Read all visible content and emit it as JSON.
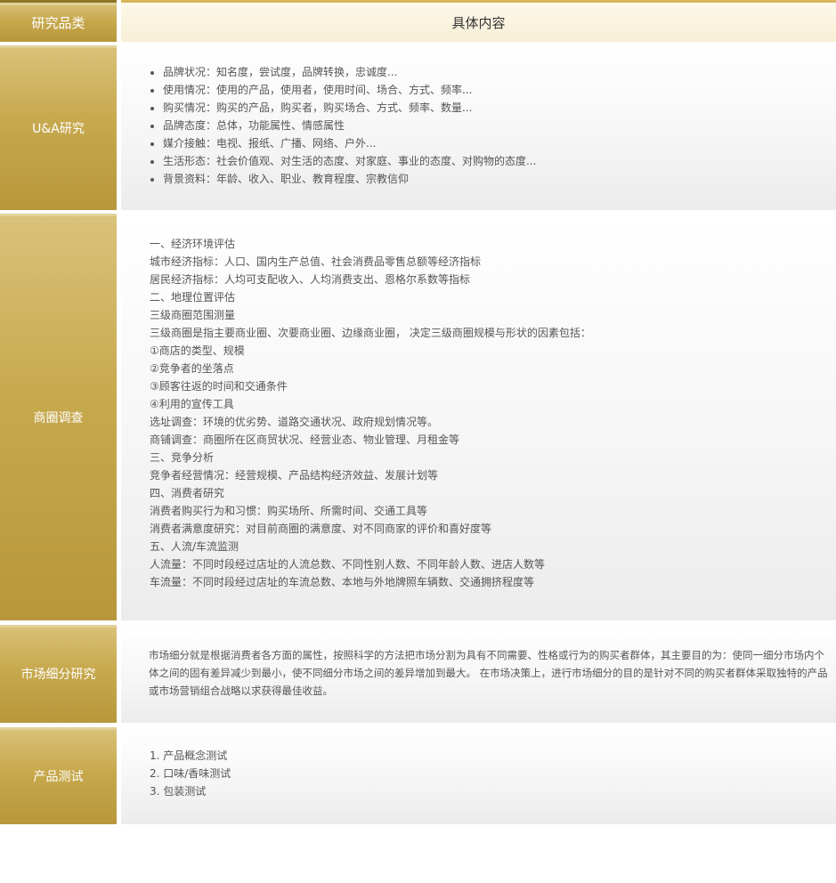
{
  "header": {
    "category": "研究品类",
    "content": "具体内容"
  },
  "ua": {
    "category": "U&A研究",
    "items": [
      "品牌状况：知名度，尝试度，品牌转换，忠诚度...",
      "使用情况：使用的产品，使用者，使用时间、场合、方式、频率...",
      "购买情况：购买的产品，购买者，购买场合、方式、频率、数量...",
      "品牌态度：总体，功能属性、情感属性",
      "媒介接触：电视、报纸、广播、网络、户外...",
      "生活形态：社会价值观、对生活的态度、对家庭、事业的态度、对购物的态度...",
      "背景资料：年龄、收入、职业、教育程度、宗教信仰"
    ]
  },
  "trade": {
    "category": "商圈调查",
    "lines": [
      "一、经济环境评估",
      "城市经济指标：人口、国内生产总值、社会消费品零售总额等经济指标",
      "居民经济指标：人均可支配收入、人均消费支出、恩格尔系数等指标",
      "二、地理位置评估",
      "三级商圈范围测量",
      "三级商圈是指主要商业圈、次要商业圈、边缘商业圈， 决定三级商圈规模与形状的因素包括：",
      "①商店的类型、规模",
      "②竞争者的坐落点",
      "③顾客往返的时间和交通条件",
      "④利用的宣传工具",
      "选址调查：环境的优劣势、道路交通状况、政府规划情况等。",
      "商铺调查：商圈所在区商贸状况、经营业态、物业管理、月租金等",
      "三、竞争分析",
      "竞争者经营情况：经营规模、产品结构经济效益、发展计划等",
      "四、消费者研究",
      "消费者购买行为和习惯：购买场所、所需时间、交通工具等",
      "消费者满意度研究：对目前商圈的满意度、对不同商家的评价和喜好度等",
      "五、人流/车流监测",
      "人流量：不同时段经过店址的人流总数、不同性别人数、不同年龄人数、进店人数等",
      "车流量：不同时段经过店址的车流总数、本地与外地牌照车辆数、交通拥挤程度等"
    ]
  },
  "segment": {
    "category": "市场细分研究",
    "text": "市场细分就是根据消费者各方面的属性，按照科学的方法把市场分割为具有不同需要、性格或行为的购买者群体，其主要目的为：使同一细分市场内个体之间的固有差异减少到最小，使不同细分市场之间的差异增加到最大。 在市场决策上，进行市场细分的目的是针对不同的购买者群体采取独特的产品或市场营销组合战略以求获得最佳收益。"
  },
  "product": {
    "category": "产品测试",
    "lines": [
      "1. 产品概念测试",
      "2. 口味/香味测试",
      "3. 包装测试"
    ]
  }
}
